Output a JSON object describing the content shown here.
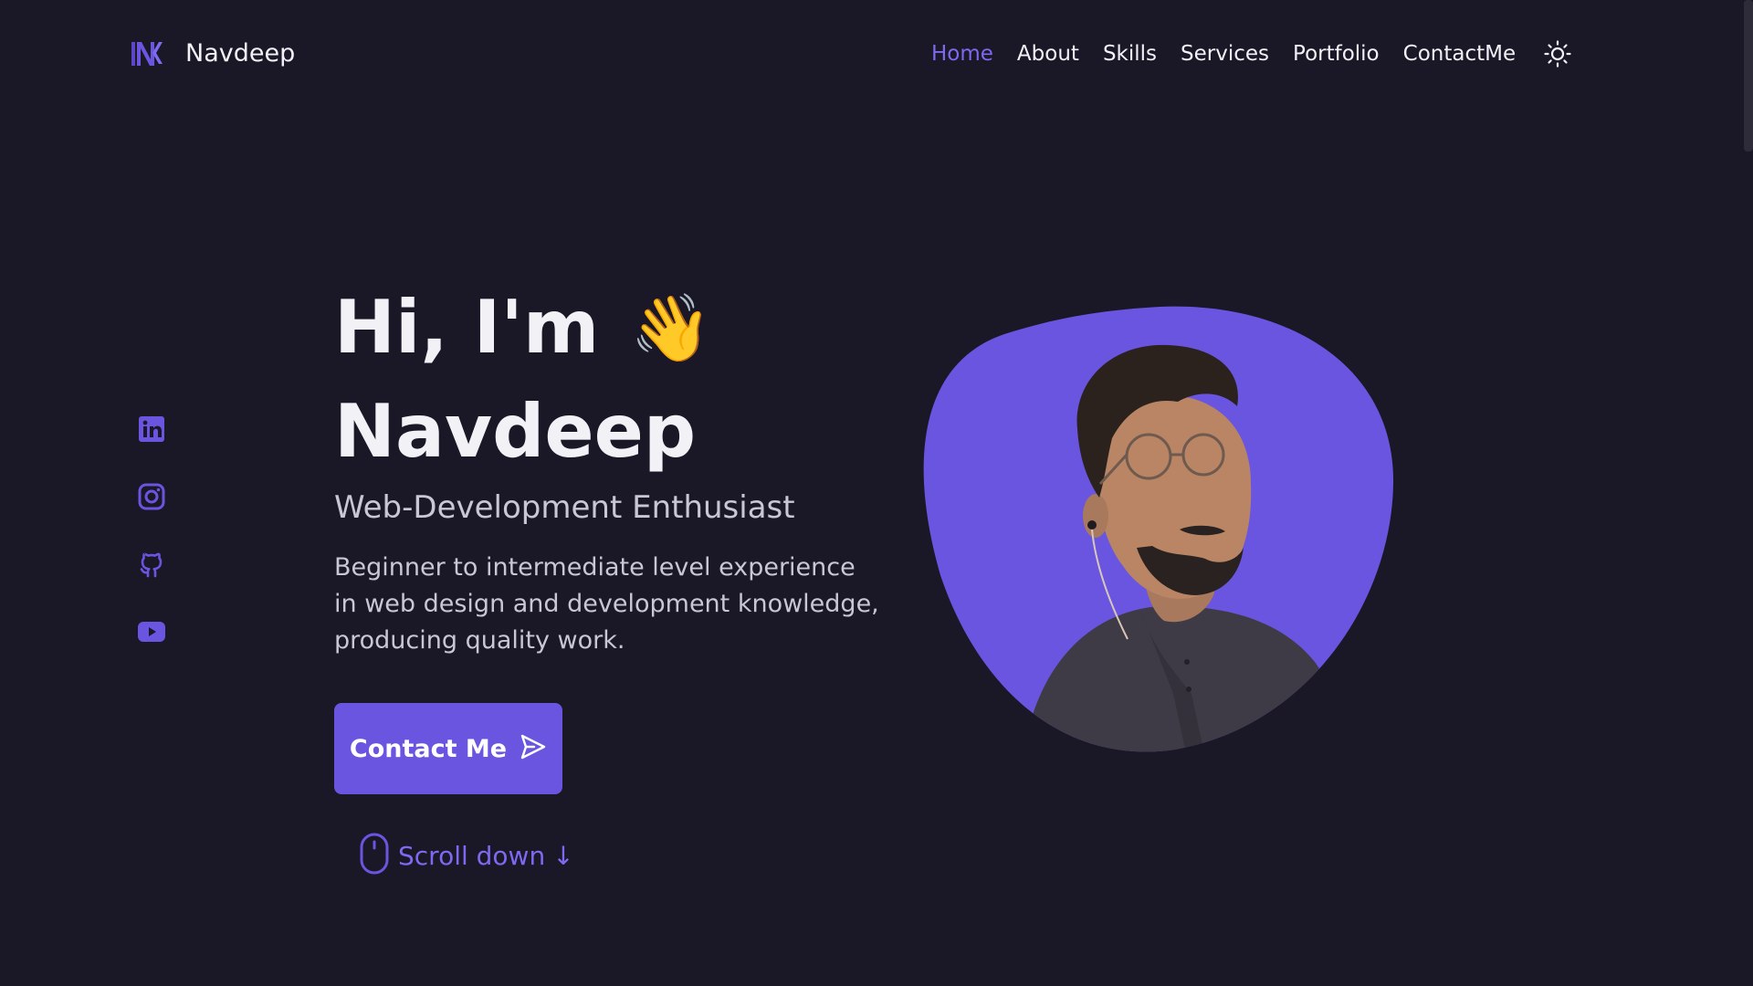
{
  "brand": {
    "logo_icon": "nk-monogram-logo",
    "name": "Navdeep",
    "accent_color": "#6a55e0",
    "background_color": "#1a1726"
  },
  "nav": {
    "items": [
      {
        "label": "Home",
        "active": true
      },
      {
        "label": "About",
        "active": false
      },
      {
        "label": "Skills",
        "active": false
      },
      {
        "label": "Services",
        "active": false
      },
      {
        "label": "Portfolio",
        "active": false
      },
      {
        "label": "ContactMe",
        "active": false
      }
    ],
    "theme_toggle_icon": "sun-icon"
  },
  "social": [
    {
      "name": "LinkedIn",
      "icon": "linkedin-icon"
    },
    {
      "name": "Instagram",
      "icon": "instagram-icon"
    },
    {
      "name": "GitHub",
      "icon": "github-icon"
    },
    {
      "name": "YouTube",
      "icon": "youtube-icon"
    }
  ],
  "hero": {
    "greeting": "Hi, I'm",
    "wave_emoji": "👋",
    "name": "Navdeep",
    "subtitle": "Web-Development Enthusiast",
    "description": "Beginner to intermediate level experience in web design and development knowledge, producing quality work.",
    "cta_label": "Contact Me",
    "cta_icon": "send-icon",
    "scroll_label": "Scroll down",
    "scroll_icon": "mouse-icon",
    "scroll_arrow": "↓"
  },
  "portrait": {
    "blob_color": "#6a55e0"
  }
}
